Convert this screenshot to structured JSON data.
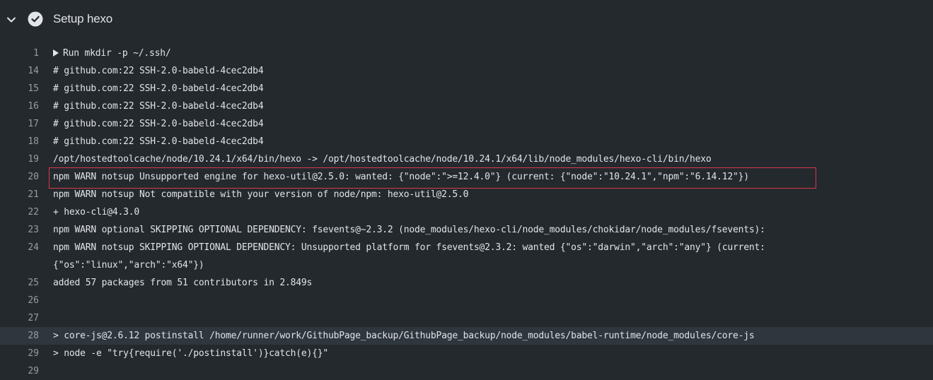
{
  "step": {
    "title": "Setup hexo",
    "status_icon": "check-circle-icon",
    "toggle_icon": "chevron-down-icon"
  },
  "log_lines": [
    {
      "num": "1",
      "text": "Run mkdir -p ~/.ssh/",
      "collapsible": true
    },
    {
      "num": "14",
      "text": "# github.com:22 SSH-2.0-babeld-4cec2db4"
    },
    {
      "num": "15",
      "text": "# github.com:22 SSH-2.0-babeld-4cec2db4"
    },
    {
      "num": "16",
      "text": "# github.com:22 SSH-2.0-babeld-4cec2db4"
    },
    {
      "num": "17",
      "text": "# github.com:22 SSH-2.0-babeld-4cec2db4"
    },
    {
      "num": "18",
      "text": "# github.com:22 SSH-2.0-babeld-4cec2db4"
    },
    {
      "num": "19",
      "text": "/opt/hostedtoolcache/node/10.24.1/x64/bin/hexo -> /opt/hostedtoolcache/node/10.24.1/x64/lib/node_modules/hexo-cli/bin/hexo"
    },
    {
      "num": "20",
      "text": "npm WARN notsup Unsupported engine for hexo-util@2.5.0: wanted: {\"node\":\">=12.4.0\"} (current: {\"node\":\"10.24.1\",\"npm\":\"6.14.12\"})",
      "boxed": true
    },
    {
      "num": "21",
      "text": "npm WARN notsup Not compatible with your version of node/npm: hexo-util@2.5.0"
    },
    {
      "num": "22",
      "text": "+ hexo-cli@4.3.0"
    },
    {
      "num": "23",
      "text": "npm WARN optional SKIPPING OPTIONAL DEPENDENCY: fsevents@~2.3.2 (node_modules/hexo-cli/node_modules/chokidar/node_modules/fsevents):"
    },
    {
      "num": "24",
      "text": "npm WARN notsup SKIPPING OPTIONAL DEPENDENCY: Unsupported platform for fsevents@2.3.2: wanted {\"os\":\"darwin\",\"arch\":\"any\"} (current:"
    },
    {
      "num": "",
      "text": "{\"os\":\"linux\",\"arch\":\"x64\"})"
    },
    {
      "num": "25",
      "text": "added 57 packages from 51 contributors in 2.849s"
    },
    {
      "num": "26",
      "text": ""
    },
    {
      "num": "27",
      "text": ""
    },
    {
      "num": "28",
      "text": "> core-js@2.6.12 postinstall /home/runner/work/GithubPage_backup/GithubPage_backup/node_modules/babel-runtime/node_modules/core-js",
      "highlight": true
    },
    {
      "num": "29",
      "text": "> node -e \"try{require('./postinstall')}catch(e){}\""
    },
    {
      "num": "29",
      "text": ""
    }
  ],
  "colors": {
    "background": "#24292e",
    "text": "#e1e4e8",
    "line_number": "#959da5",
    "highlight_row": "#2f363d",
    "annotation_box": "#d73a49"
  }
}
